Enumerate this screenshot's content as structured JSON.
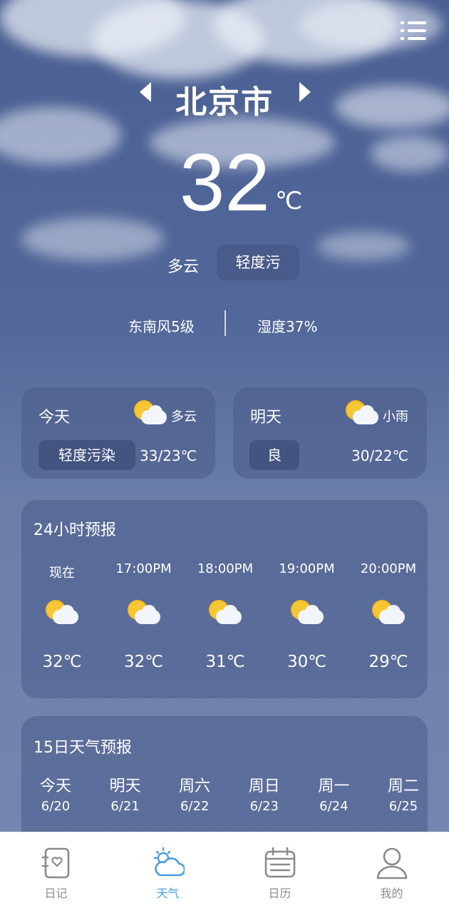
{
  "header": {
    "city": "北京市",
    "temperature": "32",
    "unit": "℃",
    "condition": "多云",
    "air_quality": "轻度污",
    "wind": "东南风5级",
    "humidity": "湿度37%"
  },
  "icons": {
    "menu": "list-menu-icon",
    "prev": "chevron-left-icon",
    "next": "chevron-right-icon",
    "weather": "partly-cloudy-icon"
  },
  "today": {
    "label": "今天",
    "condition": "多云",
    "air_quality": "轻度污染",
    "range": "33/23℃"
  },
  "tomorrow": {
    "label": "明天",
    "condition": "小雨",
    "air_quality": "良",
    "range": "30/22℃"
  },
  "hourly": {
    "title": "24小时预报",
    "items": [
      {
        "time": "现在",
        "temp": "32℃"
      },
      {
        "time": "17:00PM",
        "temp": "32℃"
      },
      {
        "time": "18:00PM",
        "temp": "31℃"
      },
      {
        "time": "19:00PM",
        "temp": "30℃"
      },
      {
        "time": "20:00PM",
        "temp": "29℃"
      }
    ]
  },
  "daily": {
    "title": "15日天气预报",
    "items": [
      {
        "day": "今天",
        "date": "6/20"
      },
      {
        "day": "明天",
        "date": "6/21"
      },
      {
        "day": "周六",
        "date": "6/22"
      },
      {
        "day": "周日",
        "date": "6/23"
      },
      {
        "day": "周一",
        "date": "6/24"
      },
      {
        "day": "周二",
        "date": "6/25"
      }
    ]
  },
  "tabs": [
    {
      "label": "日记",
      "icon": "diary-icon"
    },
    {
      "label": "天气",
      "icon": "weather-cloud-icon",
      "active": true
    },
    {
      "label": "日历",
      "icon": "calendar-icon"
    },
    {
      "label": "我的",
      "icon": "user-icon"
    }
  ],
  "colors": {
    "accent": "#4a9de0",
    "tab_inactive": "#8a8a8a",
    "sun": "#f7c733"
  }
}
